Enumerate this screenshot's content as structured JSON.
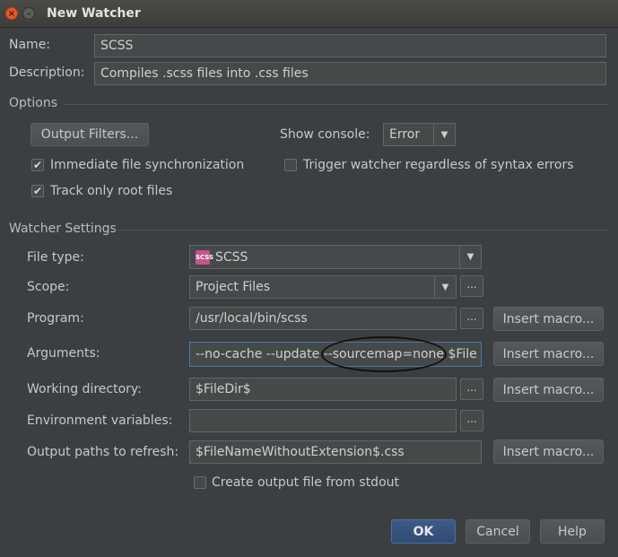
{
  "window": {
    "title": "New Watcher"
  },
  "name": {
    "label": "Name:",
    "value": "SCSS"
  },
  "description": {
    "label": "Description:",
    "value": "Compiles .scss files into .css files"
  },
  "options": {
    "title": "Options",
    "output_filters_label": "Output Filters...",
    "show_console_label": "Show console:",
    "show_console_value": "Error",
    "immediate_sync_label": "Immediate file synchronization",
    "immediate_sync_checked": true,
    "trigger_label": "Trigger watcher regardless of syntax errors",
    "trigger_checked": false,
    "track_root_label": "Track only root files",
    "track_root_checked": true
  },
  "watcher": {
    "title": "Watcher Settings",
    "file_type_label": "File type:",
    "file_type_value": "SCSS",
    "file_type_icon": "scss-icon",
    "file_type_icon_text": "SCSS",
    "scope_label": "Scope:",
    "scope_value": "Project Files",
    "program_label": "Program:",
    "program_value": "/usr/local/bin/scss",
    "arguments_label": "Arguments:",
    "arguments_value": "--no-cache --update --sourcemap=none $File",
    "working_dir_label": "Working directory:",
    "working_dir_value": "$FileDir$",
    "env_label": "Environment variables:",
    "env_value": "",
    "output_paths_label": "Output paths to refresh:",
    "output_paths_value": "$FileNameWithoutExtension$.css",
    "create_output_label": "Create output file from stdout",
    "create_output_checked": false,
    "insert_macro_label": "Insert macro...",
    "dots_label": "..."
  },
  "footer": {
    "ok_label": "OK",
    "cancel_label": "Cancel",
    "help_label": "Help"
  },
  "colors": {
    "background": "#3c3f41",
    "field": "#45494a",
    "primary": "#2f4c74",
    "close": "#e8582c"
  }
}
